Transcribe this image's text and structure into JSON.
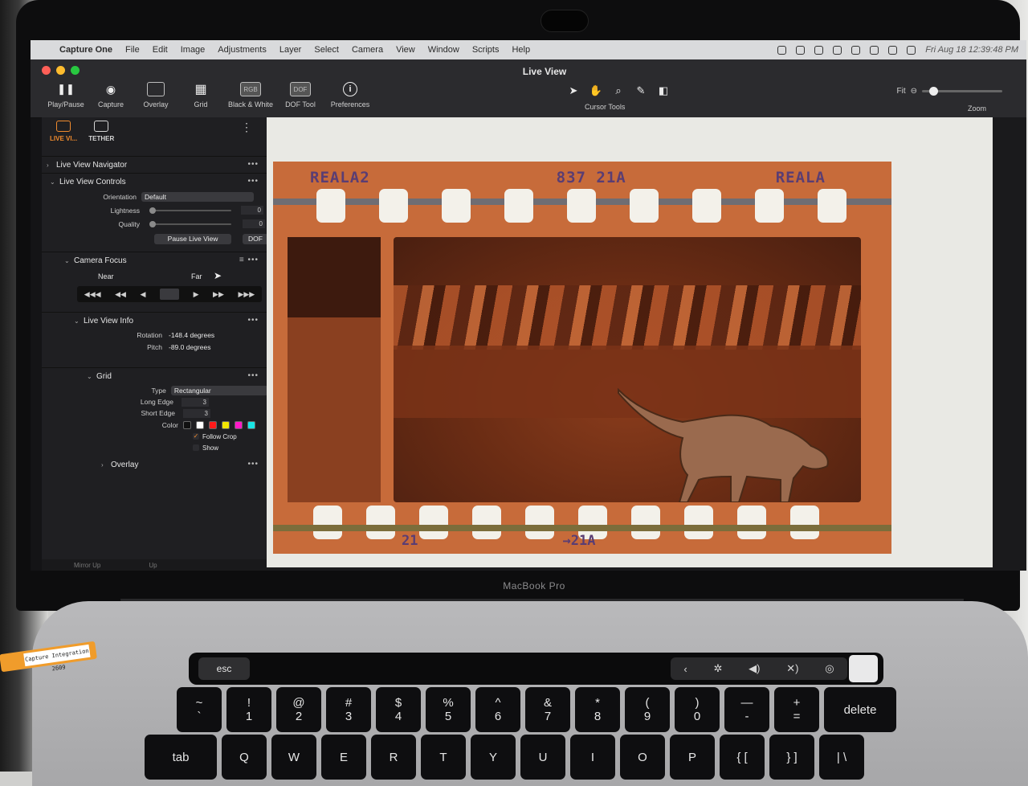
{
  "device": {
    "lid_label": "MacBook Pro"
  },
  "menubar": {
    "apple": "",
    "app_name": "Capture One",
    "items": [
      "File",
      "Edit",
      "Image",
      "Adjustments",
      "Layer",
      "Select",
      "Camera",
      "View",
      "Window",
      "Scripts",
      "Help"
    ],
    "clock": "Fri Aug 18  12:39:48 PM"
  },
  "window": {
    "title": "Live View"
  },
  "toolbar": {
    "tools": [
      {
        "label": "Play/Pause",
        "icon": "pause-icon",
        "glyph": "❚❚"
      },
      {
        "label": "Capture",
        "icon": "camera-icon",
        "glyph": "◉"
      },
      {
        "label": "Overlay",
        "icon": "overlay-icon",
        "glyph": ""
      },
      {
        "label": "Grid",
        "icon": "grid-icon",
        "glyph": "▦"
      },
      {
        "label": "Black & White",
        "icon": "rgb-icon",
        "glyph": "RGB"
      },
      {
        "label": "DOF Tool",
        "icon": "dof-icon",
        "glyph": "DOF"
      },
      {
        "label": "Preferences",
        "icon": "info-icon",
        "glyph": "i"
      }
    ],
    "cursor_tools_label": "Cursor Tools",
    "zoom_fit": "Fit",
    "zoom_label": "Zoom",
    "zoom_level": 0.1
  },
  "panel": {
    "tabs": [
      {
        "label": "LIVE VI...",
        "active": true
      },
      {
        "label": "TETHER",
        "active": false
      }
    ],
    "navigator": {
      "title": "Live View Navigator"
    },
    "controls": {
      "title": "Live View Controls",
      "orientation_label": "Orientation",
      "orientation_value": "Default",
      "lightness_label": "Lightness",
      "lightness_value": "0",
      "quality_label": "Quality",
      "quality_value": "0",
      "pause_button": "Pause Live View",
      "dof_button": "DOF"
    },
    "focus": {
      "title": "Camera Focus",
      "near": "Near",
      "far": "Far",
      "steps": [
        "◀◀◀",
        "◀◀",
        "◀",
        "",
        "▶",
        "▶▶",
        "▶▶▶"
      ]
    },
    "info": {
      "title": "Live View Info",
      "rotation_label": "Rotation",
      "rotation_value": "-148.4 degrees",
      "pitch_label": "Pitch",
      "pitch_value": "-89.0 degrees"
    },
    "grid": {
      "title": "Grid",
      "type_label": "Type",
      "type_value": "Rectangular",
      "long_edge_label": "Long Edge",
      "long_edge_value": "3",
      "short_edge_label": "Short Edge",
      "short_edge_value": "3",
      "color_label": "Color",
      "colors": [
        "#111111",
        "#ffffff",
        "#ff1a1a",
        "#f2e600",
        "#ff19c8",
        "#19e6e6"
      ],
      "follow_crop": "Follow Crop",
      "show": "Show"
    },
    "overlay": {
      "title": "Overlay"
    },
    "bottom": [
      "Mirror Up",
      "Up"
    ]
  },
  "film": {
    "top_codes": [
      "REALA2",
      "837 21A",
      "REALA"
    ],
    "bottom_codes": [
      "21",
      "→21A"
    ]
  },
  "keyboard": {
    "esc": "esc",
    "number_row": [
      [
        "~",
        "`"
      ],
      [
        "!",
        "1"
      ],
      [
        "@",
        "2"
      ],
      [
        "#",
        "3"
      ],
      [
        "$",
        "4"
      ],
      [
        "%",
        "5"
      ],
      [
        "^",
        "6"
      ],
      [
        "&",
        "7"
      ],
      [
        "*",
        "8"
      ],
      [
        "(",
        "9"
      ],
      [
        ")",
        "0"
      ],
      [
        "—",
        "-"
      ],
      [
        "+",
        "="
      ],
      [
        "",
        "delete"
      ]
    ],
    "letter_row": [
      "tab",
      "Q",
      "W",
      "E",
      "R",
      "T",
      "Y",
      "U",
      "I",
      "O",
      "P",
      "{ [",
      "} ]",
      "| \\"
    ],
    "touchbar": [
      "‹",
      "✲",
      "◀)",
      "✕)",
      "◎"
    ]
  },
  "tag": {
    "text": "Capture Integration 2609"
  }
}
